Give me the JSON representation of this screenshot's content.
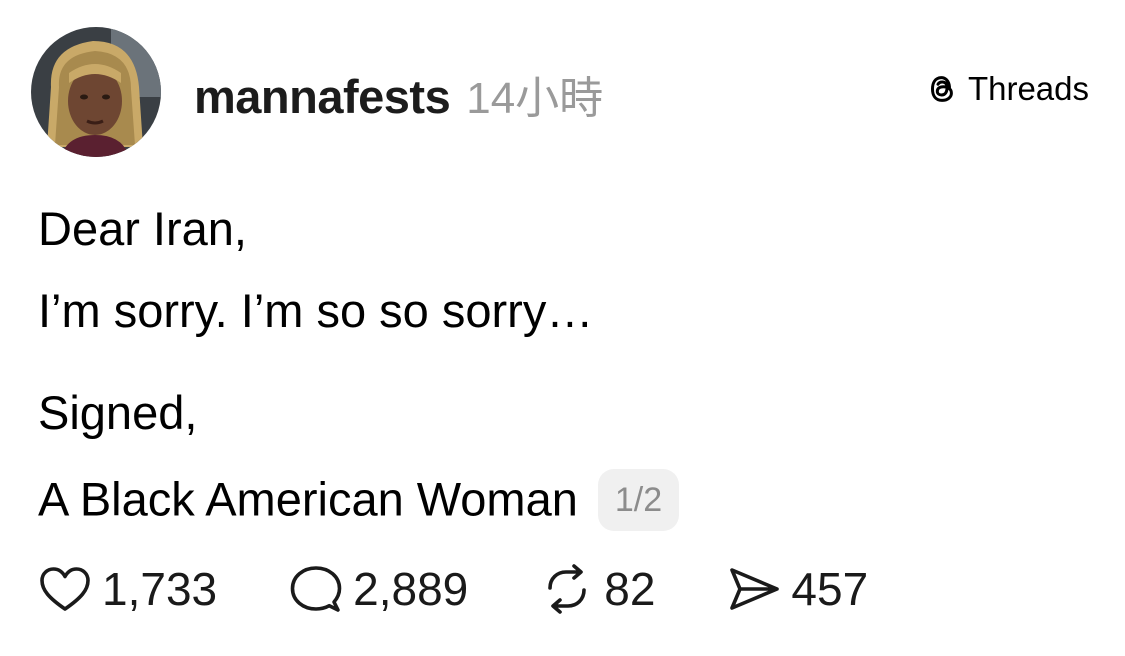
{
  "post": {
    "username": "mannafests",
    "timestamp": "14小時",
    "brand": {
      "label": "Threads",
      "icon": "threads-logo-icon"
    },
    "lines": [
      "Dear Iran,",
      "I’m sorry. I’m so so sorry…",
      "Signed,",
      "A Black American Woman"
    ],
    "page_badge": "1/2",
    "actions": {
      "likes": "1,733",
      "replies": "2,889",
      "reposts": "82",
      "shares": "457"
    },
    "icons": {
      "like": "heart-icon",
      "reply": "comment-bubble-icon",
      "repost": "repost-icon",
      "share": "send-icon"
    }
  }
}
